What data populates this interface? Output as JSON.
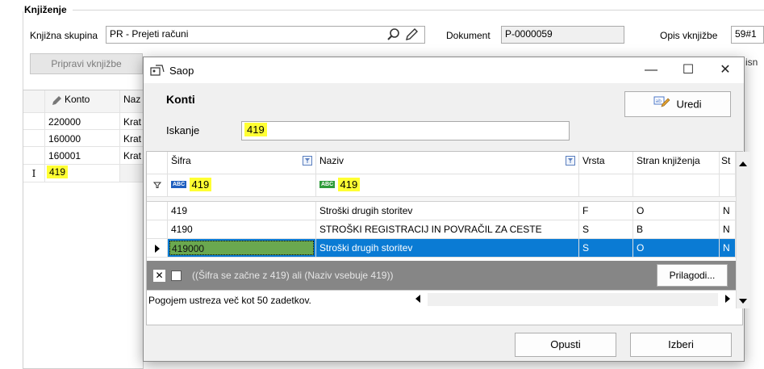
{
  "form": {
    "group_title": "Knjiženje",
    "knjizna_label": "Knjižna skupina",
    "knjizna_value": "PR - Prejeti računi",
    "dokument_label": "Dokument",
    "dokument_value": "P-0000059",
    "opis_label": "Opis vknjižbe",
    "opis_value": "59#1",
    "pripravi_button": "Pripravi vknjižbe",
    "right_clipped": "isn",
    "grid_headers": [
      "Konto",
      "Naz"
    ],
    "grid_rows": [
      {
        "konto": "220000",
        "naziv": "Krat"
      },
      {
        "konto": "160000",
        "naziv": "Krat"
      },
      {
        "konto": "160001",
        "naziv": "Krat"
      }
    ],
    "edit_row_marker": "I",
    "edit_row_value": "419"
  },
  "dialog": {
    "title": "Saop",
    "minimize": "—",
    "maximize": "☐",
    "close": "✕",
    "heading": "Konti",
    "uredi_button": "Uredi",
    "iskanje_label": "Iskanje",
    "iskanje_value": "419",
    "columns": [
      "Šifra",
      "Naziv",
      "Vrsta",
      "Stran knjiženja",
      "St"
    ],
    "filter_sifra_tag": "ABC",
    "filter_sifra": "419",
    "filter_naziv_tag": "ABC",
    "filter_naziv": "419",
    "rows": [
      {
        "sifra": "419",
        "naziv": "Stroški drugih storitev",
        "vrsta": "F",
        "stran": "O",
        "st": "N"
      },
      {
        "sifra": "4190",
        "naziv": "STROŠKI REGISTRACIJ  IN POVRAČIL ZA CESTE",
        "vrsta": "S",
        "stran": "B",
        "st": "N"
      },
      {
        "sifra": "419000",
        "naziv": "Stroški drugih storitev",
        "vrsta": "S",
        "stran": "O",
        "st": "N"
      }
    ],
    "filter_expression": "((Šifra se začne z 419) ali (Naziv vsebuje 419))",
    "clear_filter": "✕",
    "prilagodi_button": "Prilagodi...",
    "status_text": "Pogojem ustreza več kot 50 zadetkov.",
    "opusti_button": "Opusti",
    "izberi_button": "Izberi",
    "colors": {
      "selection": "#0a7bd4",
      "highlight": "#ffff33",
      "filter_bar": "#868686"
    }
  }
}
